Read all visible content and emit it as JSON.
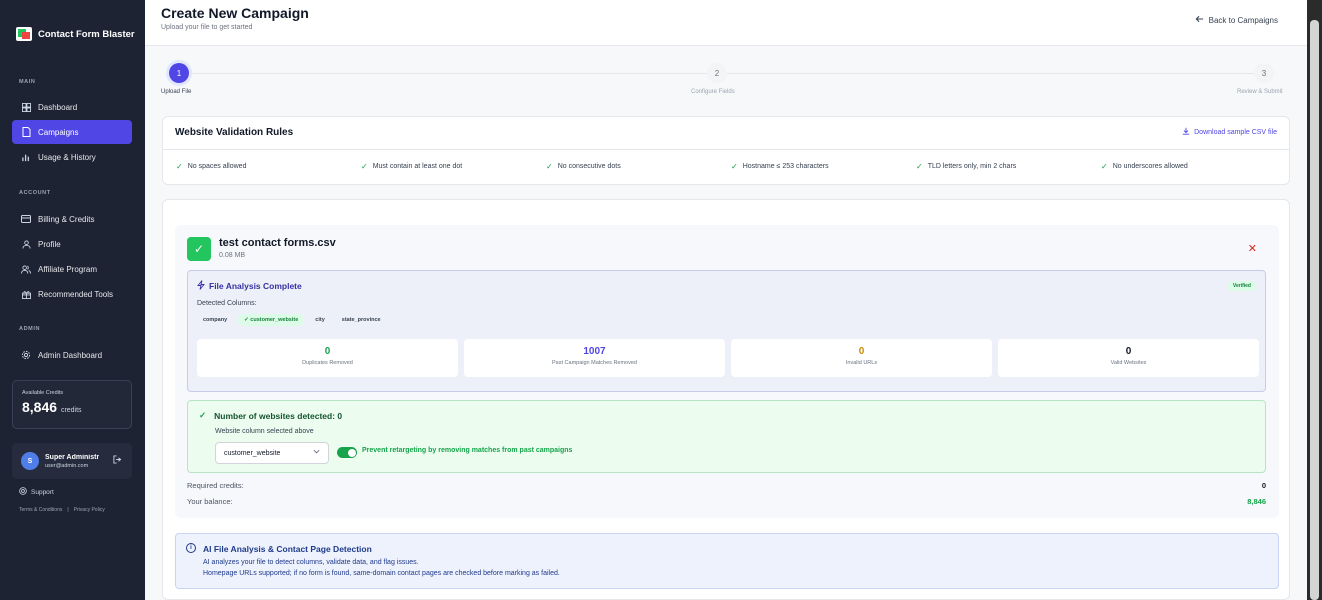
{
  "sidebar": {
    "brand": "Contact Form Blaster",
    "sections": {
      "main": "MAIN",
      "account": "ACCOUNT",
      "admin": "ADMIN"
    },
    "main_items": [
      {
        "label": "Dashboard",
        "icon": "dashboard-icon"
      },
      {
        "label": "Campaigns",
        "icon": "document-icon",
        "active": true
      },
      {
        "label": "Usage & History",
        "icon": "bar-chart-icon"
      }
    ],
    "account_items": [
      {
        "label": "Billing & Credits",
        "icon": "credit-card-icon"
      },
      {
        "label": "Profile",
        "icon": "user-icon"
      },
      {
        "label": "Affiliate Program",
        "icon": "users-icon"
      },
      {
        "label": "Recommended Tools",
        "icon": "gift-icon"
      }
    ],
    "admin_items": [
      {
        "label": "Admin Dashboard",
        "icon": "settings-icon"
      }
    ],
    "credits": {
      "label": "Available Credits",
      "value": "8,846",
      "unit": "credits"
    },
    "user": {
      "initial": "S",
      "name": "Super Administrator",
      "email": "user@admin.com"
    },
    "support": "Support",
    "legal": {
      "terms": "Terms & Conditions",
      "separator": "|",
      "privacy": "Privacy Policy"
    }
  },
  "header": {
    "title": "Create New Campaign",
    "subtitle": "Upload your file to get started",
    "back": "Back to Campaigns"
  },
  "stepper": [
    {
      "number": "1",
      "label": "Upload File",
      "active": true
    },
    {
      "number": "2",
      "label": "Configure Fields",
      "active": false
    },
    {
      "number": "3",
      "label": "Review & Submit",
      "active": false
    }
  ],
  "rules": {
    "title": "Website Validation Rules",
    "download": "Download sample CSV file",
    "items": [
      "No spaces allowed",
      "Must contain at least one dot",
      "No consecutive dots",
      "Hostname ≤ 253 characters",
      "TLD letters only, min 2 chars",
      "No underscores allowed"
    ]
  },
  "file": {
    "name": "test contact forms.csv",
    "size": "0.08 MB"
  },
  "analysis": {
    "title": "File Analysis Complete",
    "badge": "Verified",
    "detected_label": "Detected Columns:",
    "columns": [
      "company",
      "customer_website",
      "city",
      "state_province"
    ],
    "stats": [
      {
        "value": "0",
        "label": "Duplicates Removed",
        "color": "#16a34a"
      },
      {
        "value": "1007",
        "label": "Past Campaign Matches Removed",
        "color": "#4f46e5"
      },
      {
        "value": "0",
        "label": "Invalid URLs",
        "color": "#ca8a04"
      },
      {
        "value": "0",
        "label": "Valid Websites",
        "color": "#111827"
      }
    ]
  },
  "websites": {
    "title": "Number of websites detected: 0",
    "subtitle": "Website column selected above",
    "selected_column": "customer_website",
    "toggle_label": "Prevent retargeting by removing matches from past campaigns",
    "toggle_on": true
  },
  "credits_summary": {
    "required_label": "Required credits:",
    "required_value": "0",
    "balance_label": "Your balance:",
    "balance_value": "8,846"
  },
  "ai_info": {
    "title": "AI File Analysis & Contact Page Detection",
    "line1": "AI analyzes your file to detect columns, validate data, and flag issues.",
    "line2": "Homepage URLs supported; if no form is found, same-domain contact pages are checked before marking as failed."
  },
  "colors": {
    "accent": "#4f46e5",
    "sidebar": "#1e2333",
    "success": "#16a34a"
  }
}
